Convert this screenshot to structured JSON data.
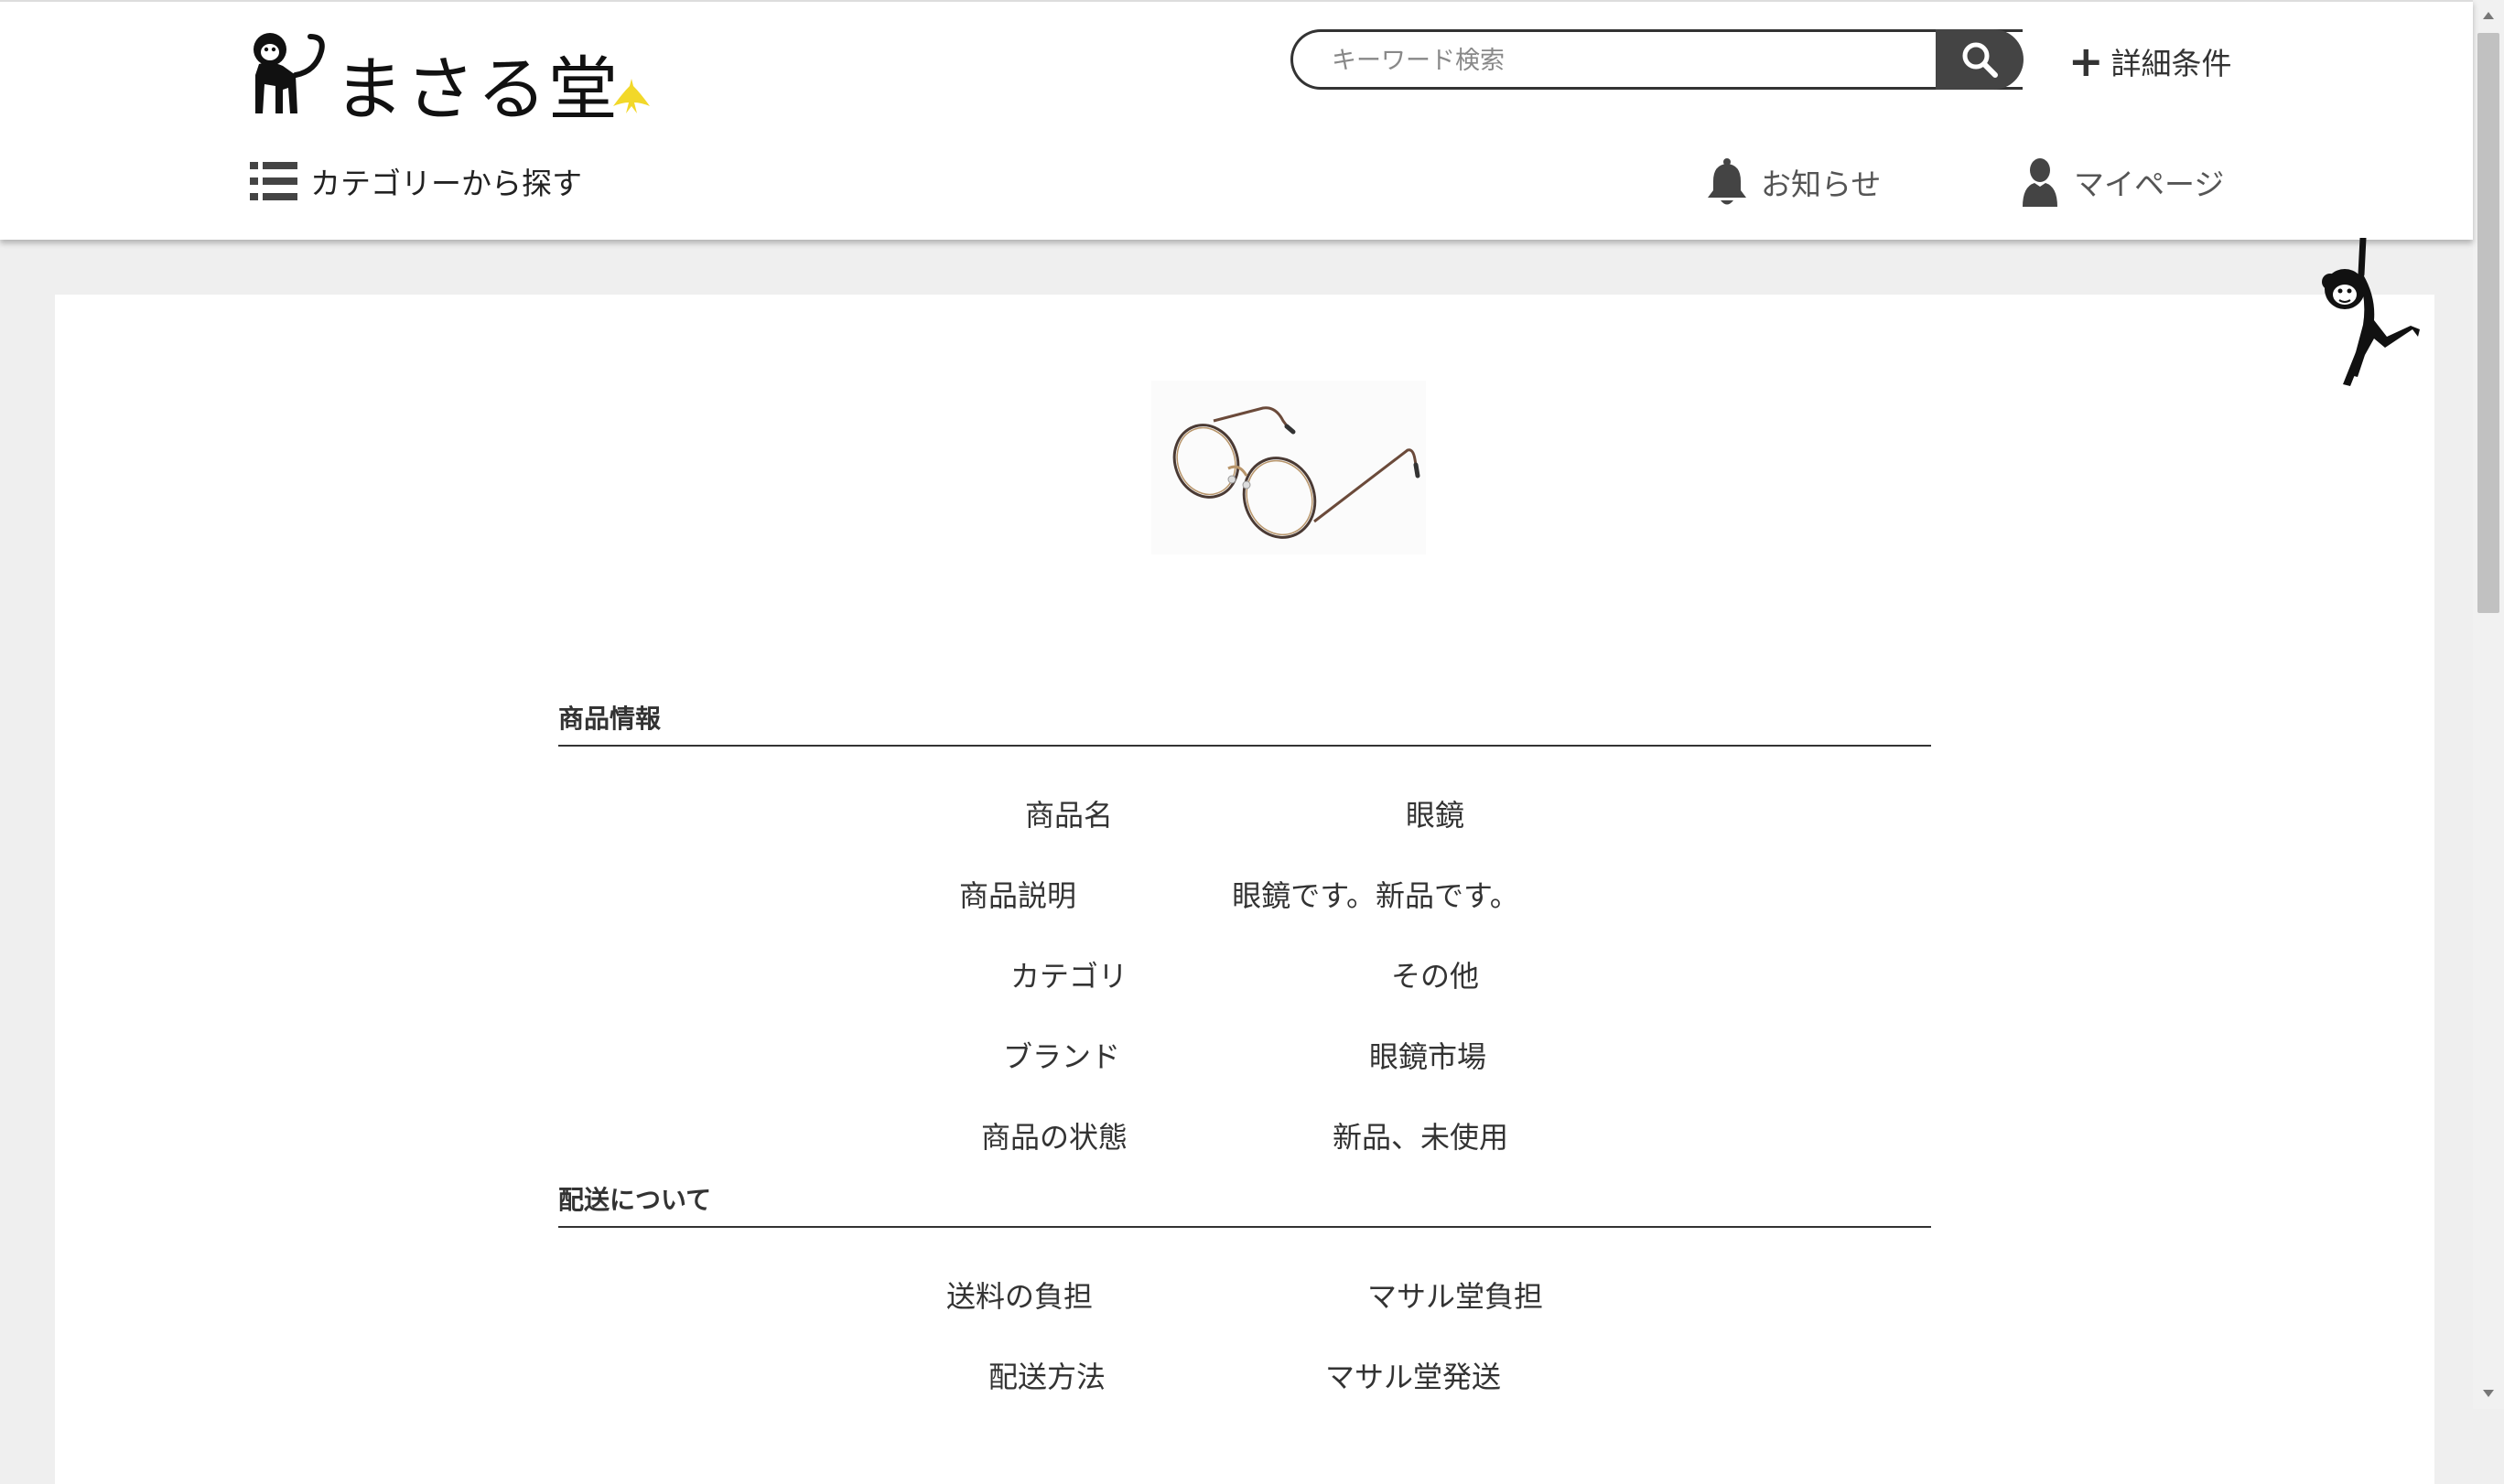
{
  "header": {
    "logo_text": "まさる堂",
    "search": {
      "placeholder": "キーワード検索",
      "value": ""
    },
    "detail_link": "詳細条件",
    "category_link": "カテゴリーから探す",
    "notifications": "お知らせ",
    "mypage": "マイページ"
  },
  "sections": {
    "product_info": {
      "title": "商品情報",
      "rows": [
        {
          "label": "商品名",
          "value": "眼鏡"
        },
        {
          "label": "商品説明",
          "value": "眼鏡です。新品です。"
        },
        {
          "label": "カテゴリ",
          "value": "その他"
        },
        {
          "label": "ブランド",
          "value": "眼鏡市場"
        },
        {
          "label": "商品の状態",
          "value": "新品、未使用"
        }
      ]
    },
    "shipping": {
      "title": "配送について",
      "rows": [
        {
          "label": "送料の負担",
          "value": "マサル堂負担"
        },
        {
          "label": "配送方法",
          "value": "マサル堂発送"
        }
      ]
    }
  },
  "icons": {
    "search": "search-icon",
    "plus": "plus-icon",
    "list": "list-icon",
    "bell": "bell-icon",
    "user": "user-icon"
  },
  "colors": {
    "accent": "#444444",
    "banana": "#f2d829"
  }
}
